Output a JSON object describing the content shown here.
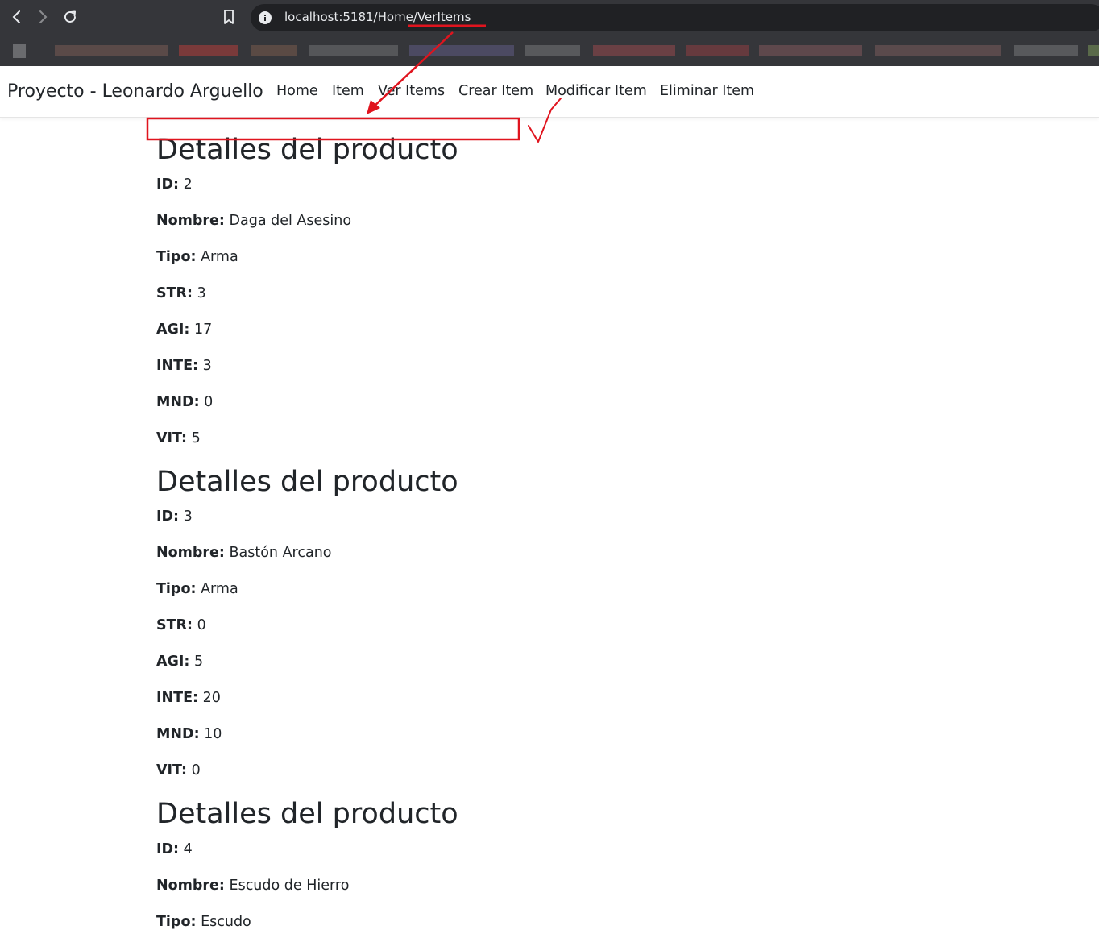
{
  "browser": {
    "url": "localhost:5181/Home/VerItems",
    "back_icon": "arrow-left-icon",
    "forward_icon": "arrow-right-icon",
    "reload_icon": "reload-icon",
    "bookmark_icon": "bookmark-icon",
    "info_icon": "info-icon"
  },
  "navbar": {
    "brand": "Proyecto - Leonardo Arguello",
    "links": [
      {
        "label": "Home"
      },
      {
        "label": "Item"
      },
      {
        "label": "Ver Items"
      },
      {
        "label": "Crear Item"
      },
      {
        "label": "Modificar Item"
      },
      {
        "label": "Eliminar Item"
      }
    ]
  },
  "field_labels": {
    "id": "ID:",
    "nombre": "Nombre:",
    "tipo": "Tipo:",
    "str": "STR:",
    "agi": "AGI:",
    "inte": "INTE:",
    "mnd": "MND:",
    "vit": "VIT:"
  },
  "products": [
    {
      "title": "Detalles del producto",
      "id": "2",
      "nombre": "Daga del Asesino",
      "tipo": "Arma",
      "str": "3",
      "agi": "17",
      "inte": "3",
      "mnd": "0",
      "vit": "5"
    },
    {
      "title": "Detalles del producto",
      "id": "3",
      "nombre": "Bastón Arcano",
      "tipo": "Arma",
      "str": "0",
      "agi": "5",
      "inte": "20",
      "mnd": "10",
      "vit": "0"
    },
    {
      "title": "Detalles del producto",
      "id": "4",
      "nombre": "Escudo de Hierro",
      "tipo": "Escudo"
    }
  ],
  "annotation_color": "#e0141e"
}
